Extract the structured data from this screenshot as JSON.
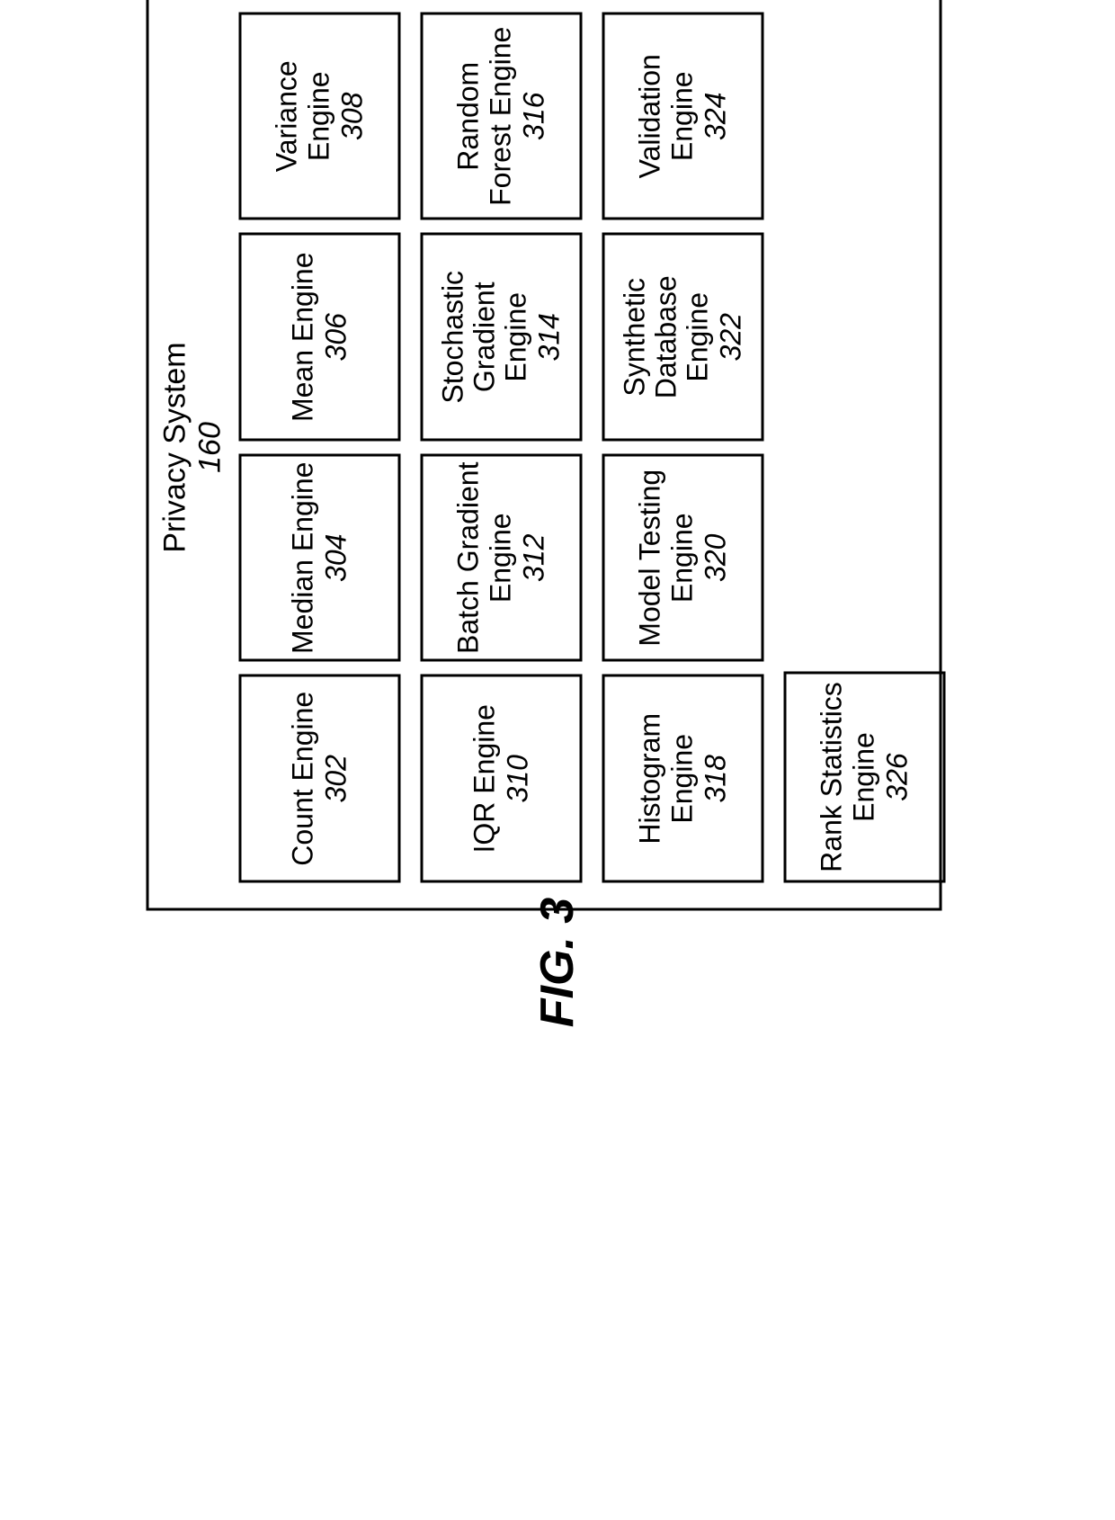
{
  "figure_label": "FIG. 3",
  "system": {
    "title": "Privacy System",
    "ref": "160"
  },
  "rows": [
    [
      {
        "label": "Count Engine",
        "ref": "302"
      },
      {
        "label": "Median Engine",
        "ref": "304"
      },
      {
        "label": "Mean Engine",
        "ref": "306"
      },
      {
        "label": "Variance Engine",
        "ref": "308"
      }
    ],
    [
      {
        "label": "IQR Engine",
        "ref": "310"
      },
      {
        "label": "Batch Gradient Engine",
        "ref": "312"
      },
      {
        "label": "Stochastic Gradient Engine",
        "ref": "314"
      },
      {
        "label": "Random Forest Engine",
        "ref": "316"
      }
    ],
    [
      {
        "label": "Histogram Engine",
        "ref": "318"
      },
      {
        "label": "Model Testing Engine",
        "ref": "320"
      },
      {
        "label": "Synthetic Database Engine",
        "ref": "322"
      },
      {
        "label": "Validation Engine",
        "ref": "324"
      }
    ],
    [
      {
        "label": "Rank Statistics Engine",
        "ref": "326"
      }
    ]
  ]
}
